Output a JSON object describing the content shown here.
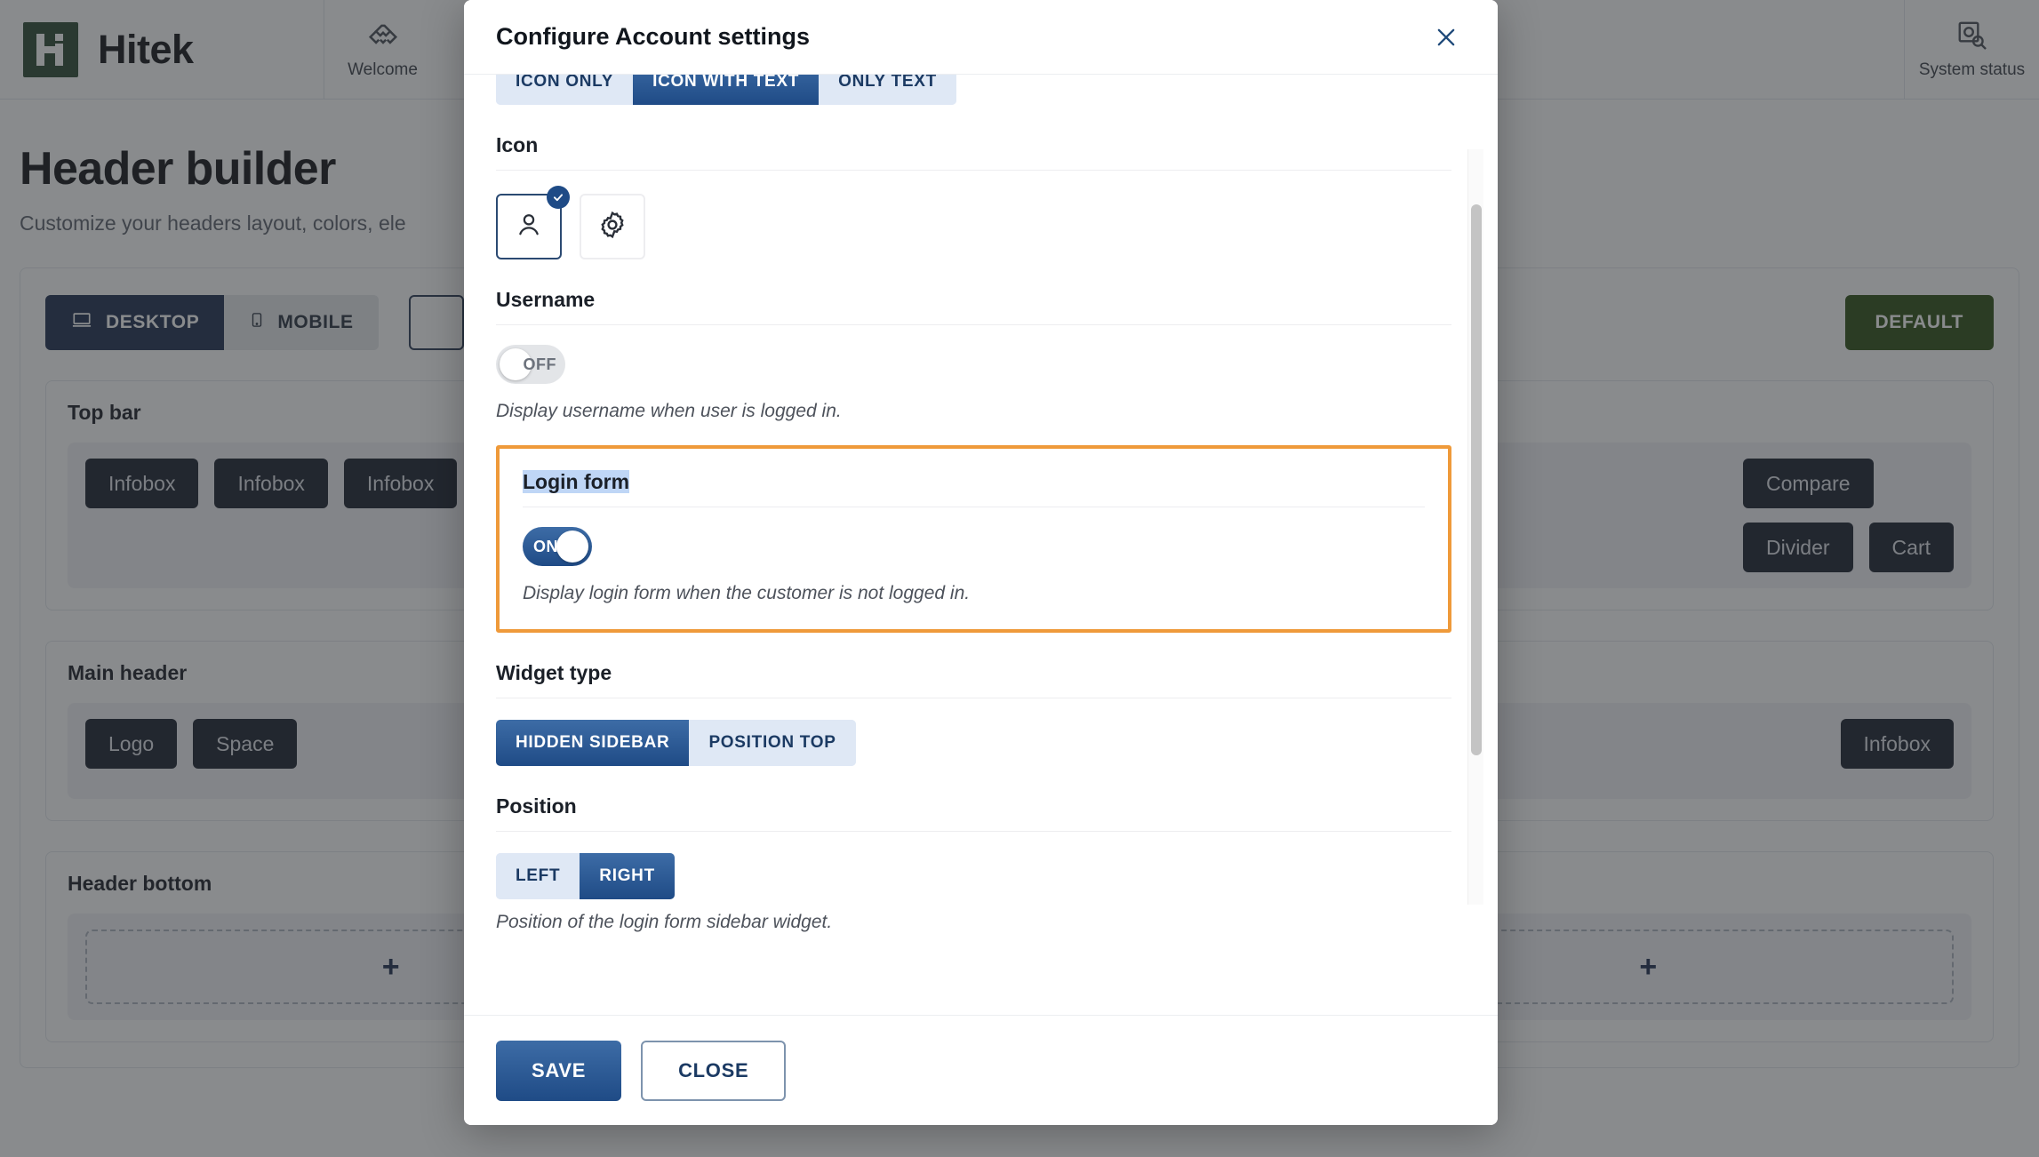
{
  "background": {
    "brand": {
      "name": "Hitek",
      "logo_icon": "hitek-logo-icon"
    },
    "nav_items": [
      {
        "label": "Welcome",
        "icon": "handshake-icon"
      },
      {
        "label": "System status",
        "icon": "system-status-icon"
      }
    ],
    "page_title": "Header builder",
    "page_subtitle": "Customize your headers layout, colors, ele",
    "toolbar": {
      "device_tabs": [
        {
          "label": "DESKTOP",
          "icon": "desktop-icon",
          "active": true
        },
        {
          "label": "MOBILE",
          "icon": "mobile-icon",
          "active": false
        }
      ],
      "default_button": "DEFAULT"
    },
    "zones": [
      {
        "title": "Top bar",
        "left_chips": [
          "Infobox",
          "Infobox",
          "Infobox"
        ],
        "right_chips_row1": [
          "Compare"
        ],
        "right_chips_row2": [
          "Divider",
          "Cart"
        ]
      },
      {
        "title": "Main header",
        "left_chips": [
          "Logo",
          "Space"
        ],
        "right_chips_row1": [
          "Infobox"
        ],
        "right_chips_row2": []
      },
      {
        "title": "Header bottom",
        "dropzone_icon": "plus-icon",
        "dropzone_count": 3
      }
    ]
  },
  "modal": {
    "title": "Configure Account settings",
    "close_icon": "close-icon",
    "display_mode": {
      "options": [
        {
          "label": "ICON ONLY",
          "active": false
        },
        {
          "label": "ICON WITH TEXT",
          "active": true
        },
        {
          "label": "ONLY TEXT",
          "active": false
        }
      ]
    },
    "icon_field": {
      "label": "Icon",
      "choices": [
        {
          "icon": "user-icon",
          "selected": true
        },
        {
          "icon": "gear-icon",
          "selected": false
        }
      ],
      "check_icon": "check-icon"
    },
    "username_field": {
      "label": "Username",
      "toggle_state": "OFF",
      "toggle_on": false,
      "help": "Display username when user is logged in."
    },
    "login_form_field": {
      "label": "Login form",
      "label_selected": true,
      "toggle_state": "ON",
      "toggle_on": true,
      "help": "Display login form when the customer is not logged in.",
      "highlight_color": "#ef9a3a"
    },
    "widget_type_field": {
      "label": "Widget type",
      "options": [
        {
          "label": "HIDDEN SIDEBAR",
          "active": true
        },
        {
          "label": "POSITION TOP",
          "active": false
        }
      ]
    },
    "position_field": {
      "label": "Position",
      "options": [
        {
          "label": "LEFT",
          "active": false
        },
        {
          "label": "RIGHT",
          "active": true
        }
      ],
      "help": "Position of the login form sidebar widget."
    },
    "footer": {
      "save_label": "SAVE",
      "close_label": "CLOSE"
    }
  }
}
